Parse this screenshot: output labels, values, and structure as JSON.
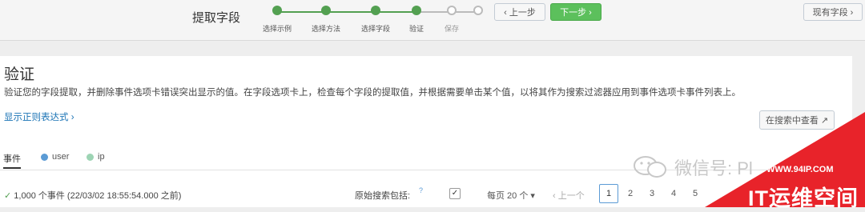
{
  "wizard": {
    "title": "提取字段",
    "steps": [
      {
        "label": "选择示例",
        "done": true
      },
      {
        "label": "选择方法",
        "done": true
      },
      {
        "label": "选择字段",
        "done": true
      },
      {
        "label": "验证",
        "done": true
      },
      {
        "label": "保存",
        "done": false
      },
      {
        "label": "",
        "done": false
      }
    ],
    "prev_label": "‹ 上一步",
    "next_label": "下一步 ›",
    "existing_fields_label": "现有字段 ›"
  },
  "panel": {
    "title": "验证",
    "description": "验证您的字段提取，并删除事件选项卡错误突出显示的值。在字段选项卡上，检查每个字段的提取值，并根据需要单击某个值，以将其作为搜索过滤器应用到事件选项卡事件列表上。",
    "regex_link": "显示正则表达式 ›",
    "view_in_search_label": "在搜索中查看 ↗"
  },
  "tabs": [
    {
      "label": "事件",
      "active": true,
      "color": ""
    },
    {
      "label": "user",
      "active": false,
      "color": "#5b9bd5"
    },
    {
      "label": "ip",
      "active": false,
      "color": "#9dd4b4"
    }
  ],
  "results": {
    "check": "✓",
    "count_text": "1,000 个事件 (22/03/02 18:55:54.000 之前)",
    "raw_search_label": "原始搜索包括:",
    "help_mark": "?",
    "checkbox_mark": "✓",
    "per_page": "每页 20 个 ▾",
    "prev_page": "‹ 上一个",
    "pages": [
      "1",
      "2",
      "3",
      "4",
      "5"
    ],
    "active_page": "1"
  },
  "watermark": {
    "text": "微信号: Pl",
    "banner_url": "WWW.94IP.COM",
    "banner_name": "IT运维空间"
  },
  "colors": {
    "accent_green": "#5cc05c",
    "step_green": "#53a051",
    "link_blue": "#1a73b5",
    "banner_red": "#e8232a"
  }
}
